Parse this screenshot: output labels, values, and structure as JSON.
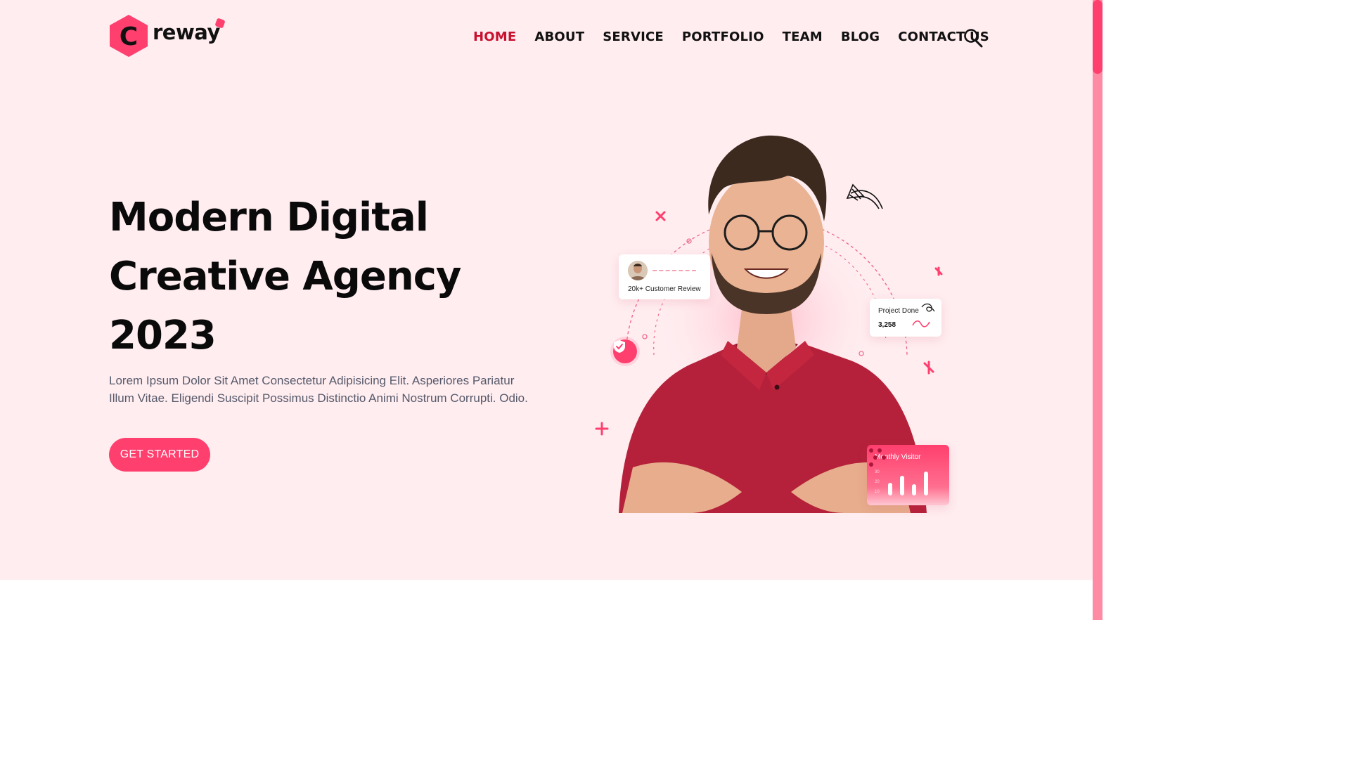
{
  "brand": {
    "logo_letter": "C",
    "logo_text": "reway",
    "accent_color": "#ff3f6e",
    "active_nav_color": "#c8102e"
  },
  "nav": {
    "items": [
      {
        "label": "HOME",
        "active": true
      },
      {
        "label": "ABOUT",
        "active": false
      },
      {
        "label": "SERVICE",
        "active": false
      },
      {
        "label": "PORTFOLIO",
        "active": false
      },
      {
        "label": "TEAM",
        "active": false
      },
      {
        "label": "BLOG",
        "active": false
      },
      {
        "label": "CONTACT US",
        "active": false
      }
    ],
    "search_icon": "search-icon"
  },
  "hero": {
    "title_lines": [
      "Modern Digital",
      "Creative Agency",
      "2023"
    ],
    "description": "Lorem Ipsum Dolor Sit Amet Consectetur Adipisicing Elit. Asperiores Pariatur Illum Vitae. Eligendi Suscipit Possimus Distinctio Animi Nostrum Corrupti. Odio.",
    "cta_label": "GET STARTED"
  },
  "illustration": {
    "review_card": {
      "label": "20k+ Customer Review"
    },
    "project_card": {
      "label": "Project Done",
      "value": "3,258"
    },
    "visitor_card": {
      "label": "Monthly Visitor",
      "axis_ticks": [
        "30",
        "20",
        "10"
      ],
      "bar_values": [
        0.45,
        0.7,
        0.4,
        0.85
      ]
    },
    "shield_icon": "shield-check-icon"
  }
}
